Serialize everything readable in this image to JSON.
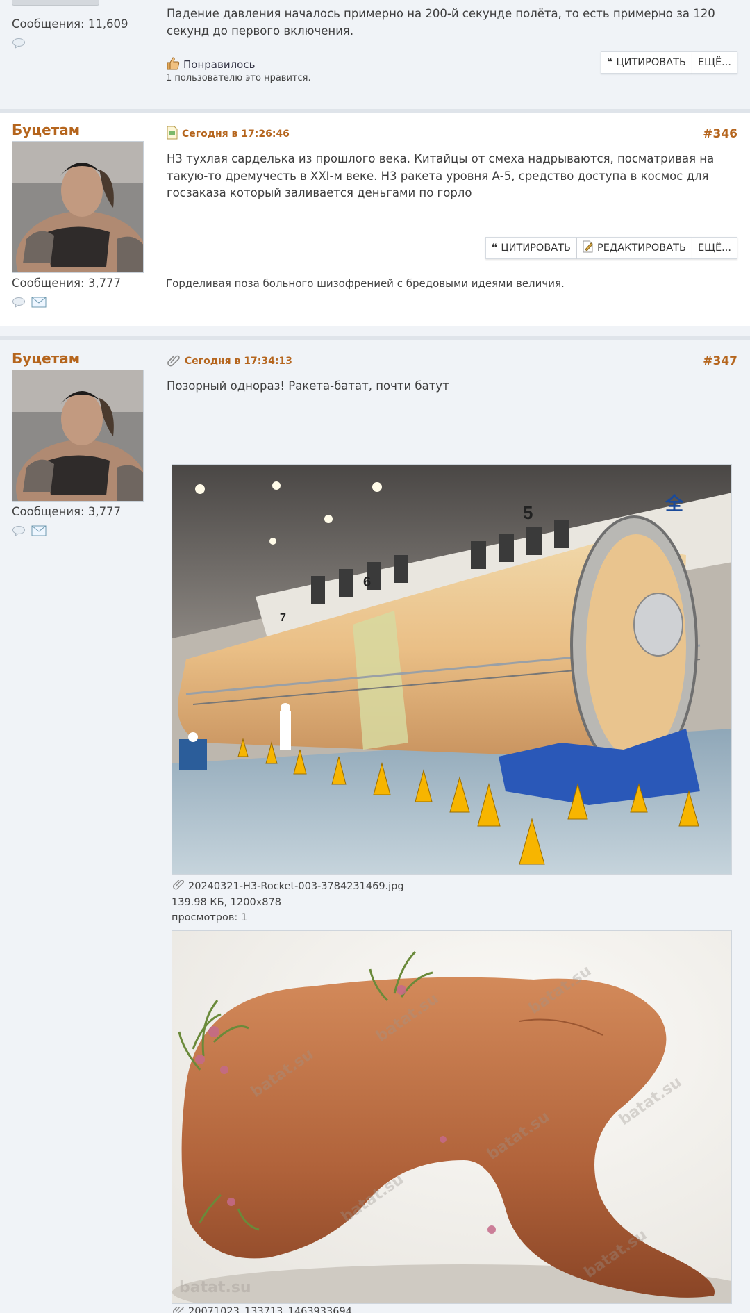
{
  "post1": {
    "message_count": "Сообщения: 11,609",
    "body": "Падение давления началось примерно на 200-й секунде полёта, то есть примерно за 120 секунд до первого включения.",
    "like_label": "Понравилось",
    "likes_text": "1 пользователю это нравится.",
    "quote_label": "ЦИТИРОВАТЬ",
    "more_label": "ЕЩЁ..."
  },
  "post2": {
    "author": "Буцетам",
    "message_count": "Сообщения: 3,777",
    "date": "Сегодня в 17:26:46",
    "number": "#346",
    "body": "Н3 тухлая сарделька из прошлого века. Китайцы от смеха надрываются, посматривая на такую-то дремучесть в XXI-м веке. Н3 ракета уровня А-5, средство доступа в космос для госзаказа который заливается деньгами по горло",
    "quote_label": "ЦИТИРОВАТЬ",
    "edit_label": "РЕДАКТИРОВАТЬ",
    "more_label": "ЕЩЁ...",
    "signature": "Горделивая поза больного шизофренией с бредовыми идеями величия."
  },
  "post3": {
    "author": "Буцетам",
    "message_count": "Сообщения: 3,777",
    "date": "Сегодня в 17:34:13",
    "number": "#347",
    "body": "Позорный однораз! Ракета-батат, почти батут",
    "attachment1": {
      "filename": "20240321-H3-Rocket-003-3784231469.jpg",
      "size": "139.98 КБ, 1200x878",
      "views": "просмотров: 1",
      "markings": [
        "5",
        "6",
        "7",
        "全"
      ]
    },
    "attachment2": {
      "watermark": "batat.su",
      "filename_partial": "20071023_133713_1463933694..."
    }
  },
  "colors": {
    "accent": "#b5651d",
    "background": "#f0f3f7",
    "post_white": "#ffffff"
  }
}
